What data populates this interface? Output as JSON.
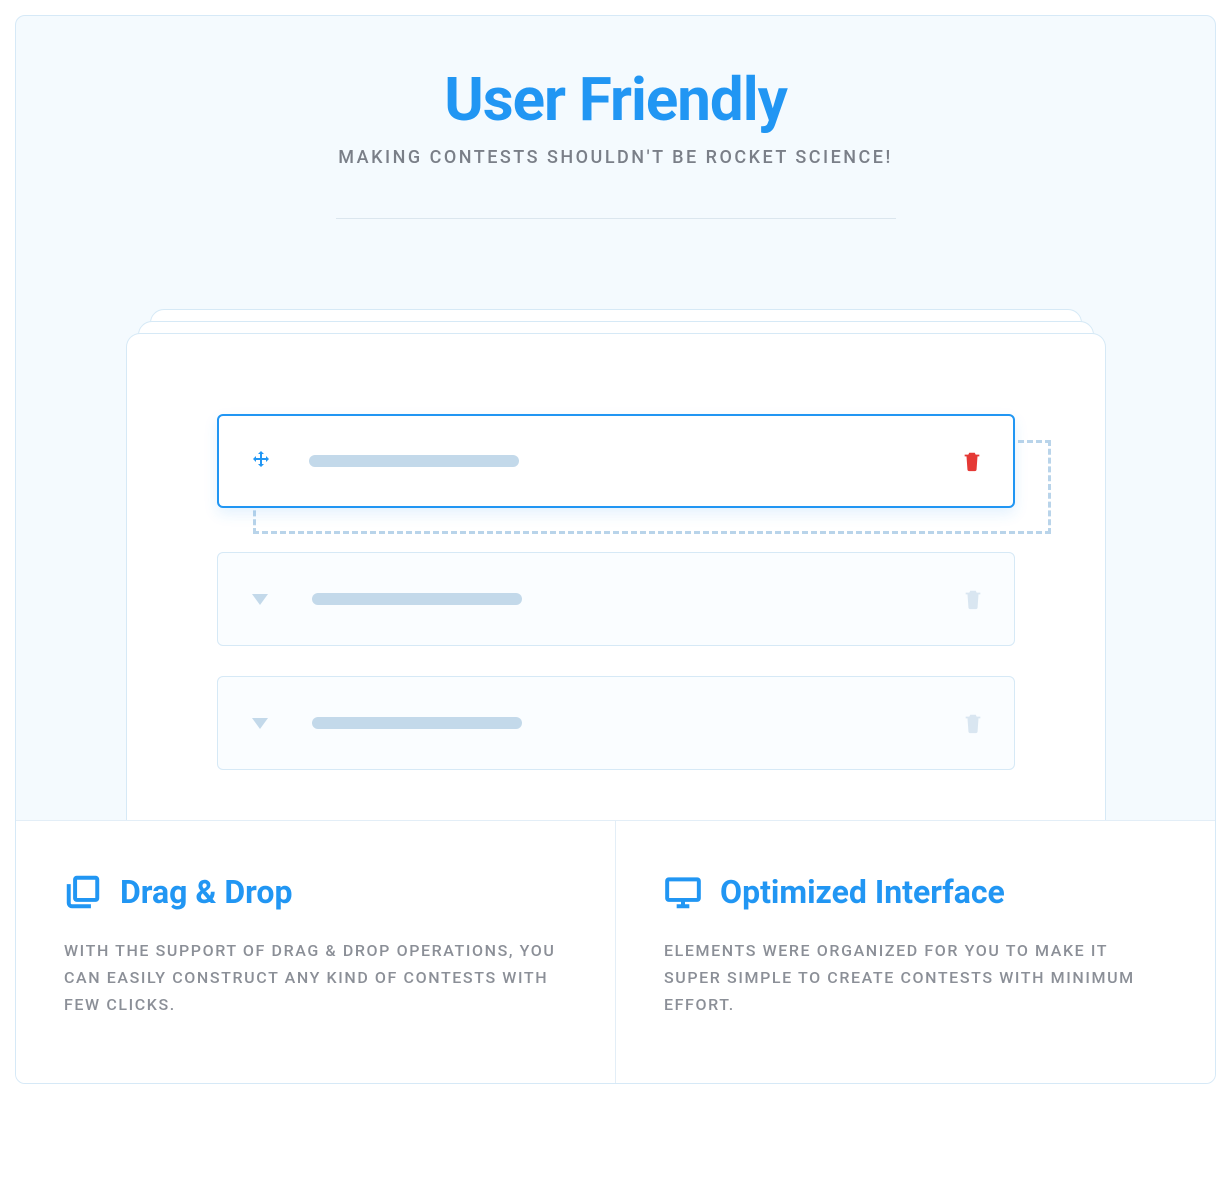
{
  "hero": {
    "title": "User Friendly",
    "subtitle": "MAKING CONTESTS SHOULDN'T BE ROCKET SCIENCE!"
  },
  "features": [
    {
      "icon": "copy-icon",
      "title": "Drag & Drop",
      "desc": "WITH THE SUPPORT OF DRAG & DROP OPERATIONS, YOU CAN EASILY CONSTRUCT ANY KIND OF CONTESTS WITH FEW CLICKS."
    },
    {
      "icon": "monitor-icon",
      "title": "Optimized Interface",
      "desc": "ELEMENTS WERE ORGANIZED FOR YOU TO MAKE IT SUPER SIMPLE TO CREATE CONTESTS WITH MINIMUM EFFORT."
    }
  ]
}
